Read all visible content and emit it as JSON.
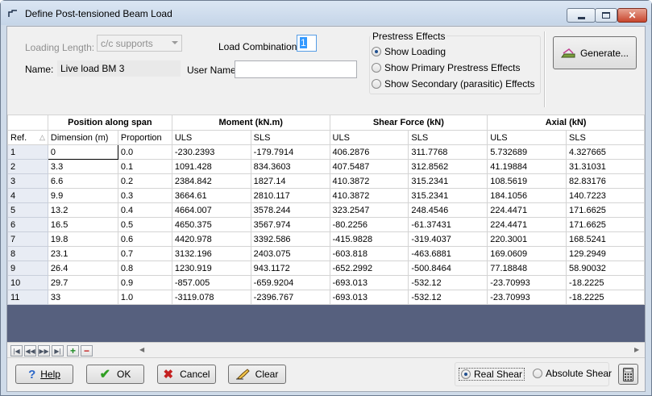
{
  "window": {
    "title": "Define Post-tensioned Beam Load"
  },
  "form": {
    "loading_length_label": "Loading Length:",
    "loading_length_value": "c/c supports",
    "name_label": "Name:",
    "name_value": "Live load BM 3",
    "load_combination_label": "Load Combination:",
    "load_combination_value": "1",
    "user_name_label": "User Name:",
    "user_name_value": ""
  },
  "prestress": {
    "group_title": "Prestress Effects",
    "options": [
      {
        "label": "Show Loading",
        "selected": true
      },
      {
        "label": "Show Primary Prestress Effects",
        "selected": false
      },
      {
        "label": "Show Secondary (parasitic) Effects",
        "selected": false
      }
    ]
  },
  "generate_label": "Generate...",
  "table": {
    "group_headers": [
      "Position along span",
      "Moment (kN.m)",
      "Shear Force (kN)",
      "Axial (kN)"
    ],
    "columns": [
      "Ref.",
      "Dimension (m)",
      "Proportion",
      "ULS",
      "SLS",
      "ULS",
      "SLS",
      "ULS",
      "SLS"
    ],
    "rows": [
      [
        "1",
        "0",
        "0.0",
        "-230.2393",
        "-179.7914",
        "406.2876",
        "311.7768",
        "5.732689",
        "4.327665"
      ],
      [
        "2",
        "3.3",
        "0.1",
        "1091.428",
        "834.3603",
        "407.5487",
        "312.8562",
        "41.19884",
        "31.31031"
      ],
      [
        "3",
        "6.6",
        "0.2",
        "2384.842",
        "1827.14",
        "410.3872",
        "315.2341",
        "108.5619",
        "82.83176"
      ],
      [
        "4",
        "9.9",
        "0.3",
        "3664.61",
        "2810.117",
        "410.3872",
        "315.2341",
        "184.1056",
        "140.7223"
      ],
      [
        "5",
        "13.2",
        "0.4",
        "4664.007",
        "3578.244",
        "323.2547",
        "248.4546",
        "224.4471",
        "171.6625"
      ],
      [
        "6",
        "16.5",
        "0.5",
        "4650.375",
        "3567.974",
        "-80.2256",
        "-61.37431",
        "224.4471",
        "171.6625"
      ],
      [
        "7",
        "19.8",
        "0.6",
        "4420.978",
        "3392.586",
        "-415.9828",
        "-319.4037",
        "220.3001",
        "168.5241"
      ],
      [
        "8",
        "23.1",
        "0.7",
        "3132.196",
        "2403.075",
        "-603.818",
        "-463.6881",
        "169.0609",
        "129.2949"
      ],
      [
        "9",
        "26.4",
        "0.8",
        "1230.919",
        "943.1172",
        "-652.2992",
        "-500.8464",
        "77.18848",
        "58.90032"
      ],
      [
        "10",
        "29.7",
        "0.9",
        "-857.005",
        "-659.9204",
        "-693.013",
        "-532.12",
        "-23.70993",
        "-18.2225"
      ],
      [
        "11",
        "33",
        "1.0",
        "-3119.078",
        "-2396.767",
        "-693.013",
        "-532.12",
        "-23.70993",
        "-18.2225"
      ]
    ]
  },
  "buttons": {
    "help": "Help",
    "ok": "OK",
    "cancel": "Cancel",
    "clear": "Clear"
  },
  "shear_mode": {
    "options": [
      {
        "label": "Real Shear",
        "selected": true
      },
      {
        "label": "Absolute Shear",
        "selected": false
      }
    ]
  }
}
